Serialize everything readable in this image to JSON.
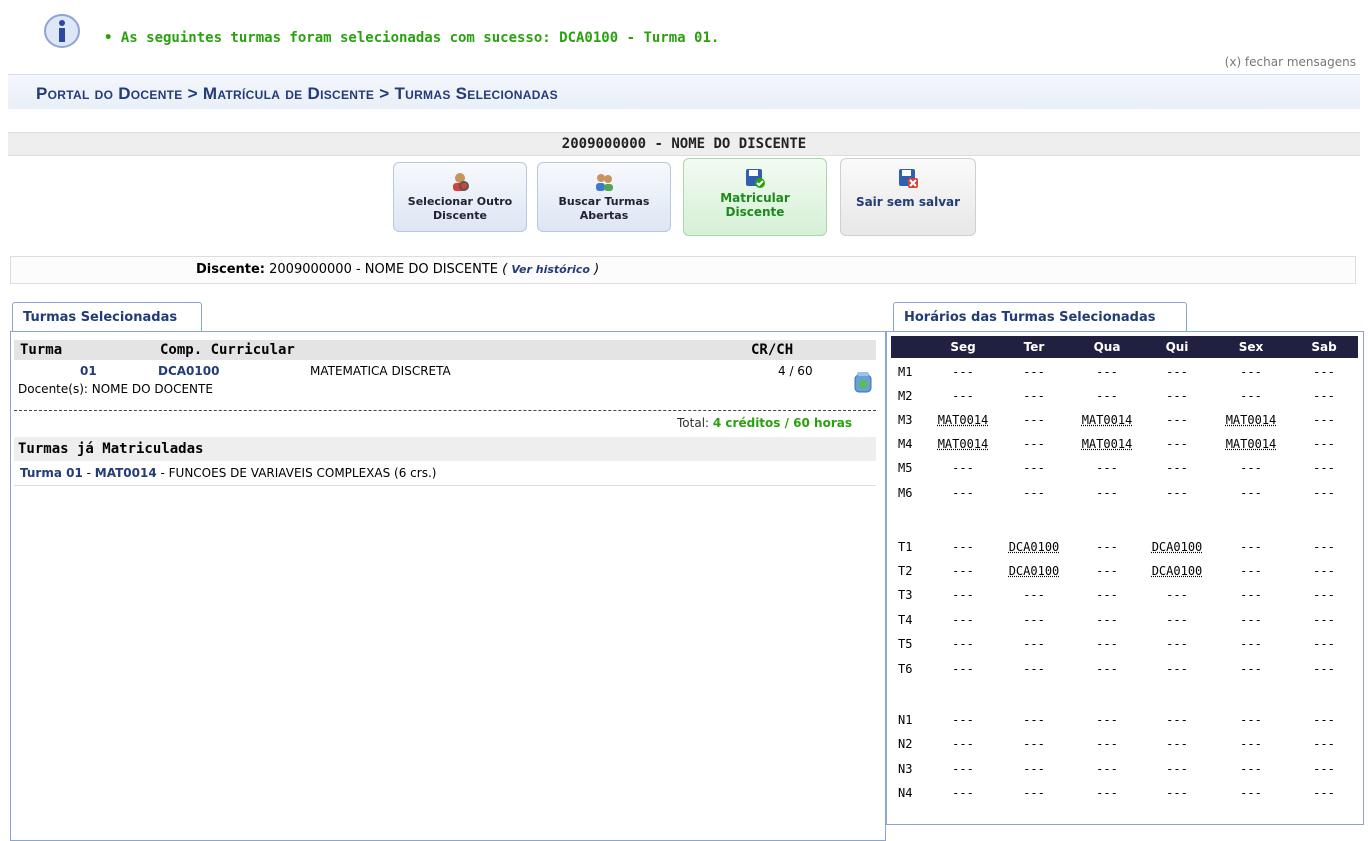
{
  "message": {
    "text": "• As seguintes turmas foram selecionadas com sucesso: DCA0100 - Turma 01.",
    "close": "(x) fechar mensagens"
  },
  "breadcrumb": "Portal do Docente > Matrícula de Discente > Turmas Selecionadas",
  "student_title": "2009000000 - NOME DO DISCENTE",
  "buttons": {
    "outro_l1": "Selecionar Outro",
    "outro_l2": "Discente",
    "buscar_l1": "Buscar Turmas",
    "buscar_l2": "Abertas",
    "matric_l1": "Matricular",
    "matric_l2": "Discente",
    "sair": "Sair sem salvar"
  },
  "discente": {
    "label": "Discente:",
    "value": "2009000000 - NOME DO DISCENTE",
    "hist": "Ver histórico"
  },
  "left_tab": "Turmas Selecionadas",
  "selecionadas": {
    "headers": {
      "turma": "Turma",
      "comp": "Comp. Curricular",
      "crch": "CR/CH"
    },
    "turma": "01",
    "codigo": "DCA0100",
    "nome": "MATEMATICA DISCRETA",
    "crch": "4 / 60",
    "docente": "Docente(s): NOME DO DOCENTE",
    "total_label": "Total:",
    "total_value": "4 créditos / 60 horas"
  },
  "matriculadas": {
    "title": "Turmas já Matriculadas",
    "turma": "Turma 01",
    "sep1": " - ",
    "codigo": "MAT0014",
    "rest": " - FUNCOES DE VARIAVEIS COMPLEXAS (6 crs.)"
  },
  "right_tab": "Horários das Turmas Selecionadas",
  "schedule": {
    "days": [
      "Seg",
      "Ter",
      "Qua",
      "Qui",
      "Sex",
      "Sab"
    ],
    "rows": [
      [
        "M1",
        "---",
        "---",
        "---",
        "---",
        "---",
        "---"
      ],
      [
        "M2",
        "---",
        "---",
        "---",
        "---",
        "---",
        "---"
      ],
      [
        "M3",
        "MAT0014",
        "---",
        "MAT0014",
        "---",
        "MAT0014",
        "---"
      ],
      [
        "M4",
        "MAT0014",
        "---",
        "MAT0014",
        "---",
        "MAT0014",
        "---"
      ],
      [
        "M5",
        "---",
        "---",
        "---",
        "---",
        "---",
        "---"
      ],
      [
        "M6",
        "---",
        "---",
        "---",
        "---",
        "---",
        "---"
      ],
      [
        "T1",
        "---",
        "DCA0100",
        "---",
        "DCA0100",
        "---",
        "---"
      ],
      [
        "T2",
        "---",
        "DCA0100",
        "---",
        "DCA0100",
        "---",
        "---"
      ],
      [
        "T3",
        "---",
        "---",
        "---",
        "---",
        "---",
        "---"
      ],
      [
        "T4",
        "---",
        "---",
        "---",
        "---",
        "---",
        "---"
      ],
      [
        "T5",
        "---",
        "---",
        "---",
        "---",
        "---",
        "---"
      ],
      [
        "T6",
        "---",
        "---",
        "---",
        "---",
        "---",
        "---"
      ],
      [
        "N1",
        "---",
        "---",
        "---",
        "---",
        "---",
        "---"
      ],
      [
        "N2",
        "---",
        "---",
        "---",
        "---",
        "---",
        "---"
      ],
      [
        "N3",
        "---",
        "---",
        "---",
        "---",
        "---",
        "---"
      ],
      [
        "N4",
        "---",
        "---",
        "---",
        "---",
        "---",
        "---"
      ]
    ]
  }
}
